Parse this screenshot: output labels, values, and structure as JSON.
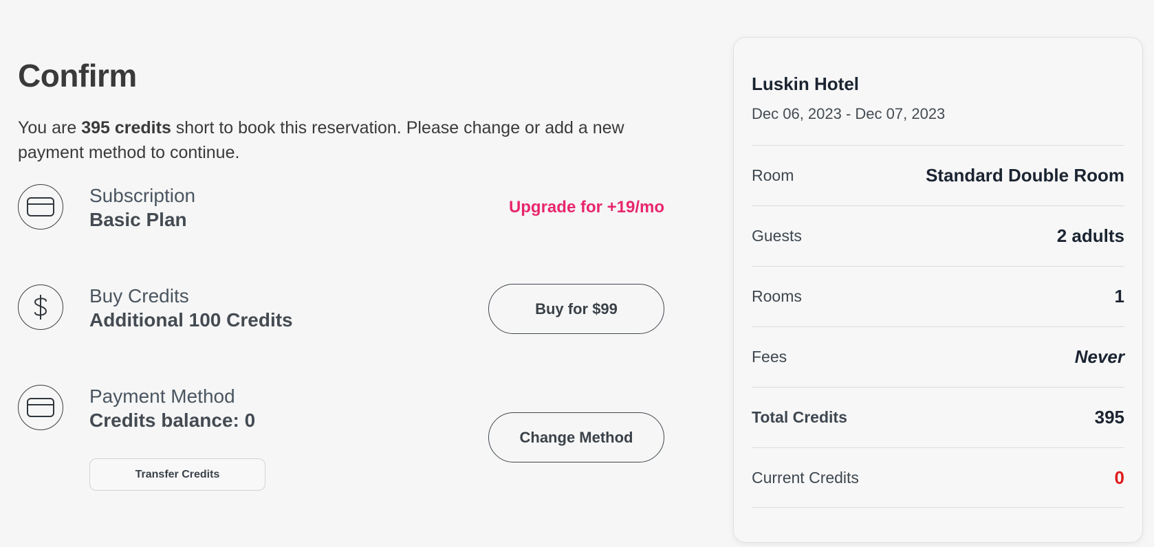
{
  "page": {
    "title": "Confirm",
    "intro_prefix": "You are ",
    "intro_bold": "395 credits",
    "intro_suffix": " short to book this reservation. Please change or add a new payment method to continue."
  },
  "subscription": {
    "label": "Subscription",
    "value": "Basic Plan",
    "action_label": "Upgrade for +19/mo",
    "icon": "credit-card-icon"
  },
  "buy_credits": {
    "label": "Buy Credits",
    "value": "Additional 100 Credits",
    "action_label": "Buy for $99",
    "icon": "dollar-icon"
  },
  "payment_method": {
    "label": "Payment Method",
    "value": "Credits balance: 0",
    "action_label": "Change Method",
    "secondary_action_label": "Transfer Credits",
    "icon": "credit-card-icon"
  },
  "summary": {
    "hotel_name": "Luskin Hotel",
    "dates": "Dec 06, 2023 - Dec 07, 2023",
    "rows": [
      {
        "label": "Room",
        "value": "Standard Double Room"
      },
      {
        "label": "Guests",
        "value": "2 adults"
      },
      {
        "label": "Rooms",
        "value": "1"
      },
      {
        "label": "Fees",
        "value": "Never"
      },
      {
        "label": "Total Credits",
        "value": "395"
      },
      {
        "label": "Current Credits",
        "value": "0"
      }
    ]
  },
  "colors": {
    "accent_pink": "#e8266d",
    "negative_red": "#e01b1b",
    "background": "#f6f6f6"
  }
}
